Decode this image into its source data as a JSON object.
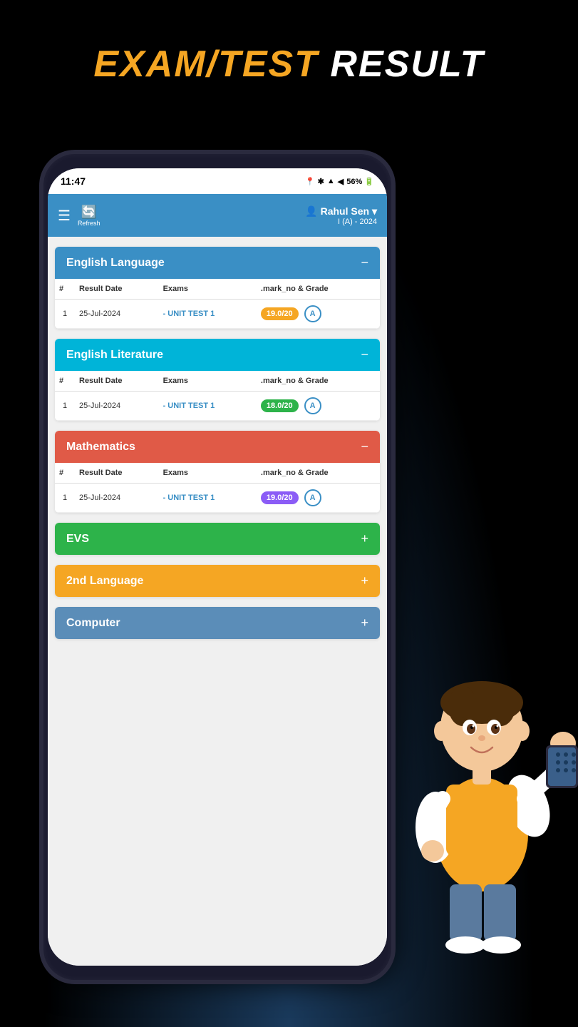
{
  "page": {
    "title_orange": "EXAM/TEST",
    "title_white": " RESULT"
  },
  "status_bar": {
    "time": "11:47",
    "icons": "📍 ✱ ▲ ◀ 56%"
  },
  "header": {
    "user_icon": "👤",
    "user_name": "Rahul Sen",
    "user_class": "I (A) - 2024",
    "refresh_label": "Refresh"
  },
  "subjects": [
    {
      "id": "english-language",
      "name": "English Language",
      "color": "blue",
      "expanded": true,
      "columns": [
        "#",
        "Result Date",
        "Exams",
        ".mark_no & Grade"
      ],
      "rows": [
        {
          "num": "1",
          "date": "25-Jul-2024",
          "exam": "- UNIT TEST 1",
          "mark": "19.0/20",
          "mark_color": "orange-bg",
          "grade": "A"
        }
      ]
    },
    {
      "id": "english-literature",
      "name": "English Literature",
      "color": "cyan",
      "expanded": true,
      "columns": [
        "#",
        "Result Date",
        "Exams",
        ".mark_no & Grade"
      ],
      "rows": [
        {
          "num": "1",
          "date": "25-Jul-2024",
          "exam": "- UNIT TEST 1",
          "mark": "18.0/20",
          "mark_color": "green-bg",
          "grade": "A"
        }
      ]
    },
    {
      "id": "mathematics",
      "name": "Mathematics",
      "color": "red",
      "expanded": true,
      "columns": [
        "#",
        "Result Date",
        "Exams",
        ".mark_no & Grade"
      ],
      "rows": [
        {
          "num": "1",
          "date": "25-Jul-2024",
          "exam": "- UNIT TEST 1",
          "mark": "19.0/20",
          "mark_color": "purple-bg",
          "grade": "A"
        }
      ]
    },
    {
      "id": "evs",
      "name": "EVS",
      "color": "green",
      "expanded": false,
      "toggle": "+"
    },
    {
      "id": "2nd-language",
      "name": "2nd Language",
      "color": "orange",
      "expanded": false,
      "toggle": "+"
    },
    {
      "id": "computer",
      "name": "Computer",
      "color": "steel",
      "expanded": false,
      "toggle": "+"
    }
  ]
}
